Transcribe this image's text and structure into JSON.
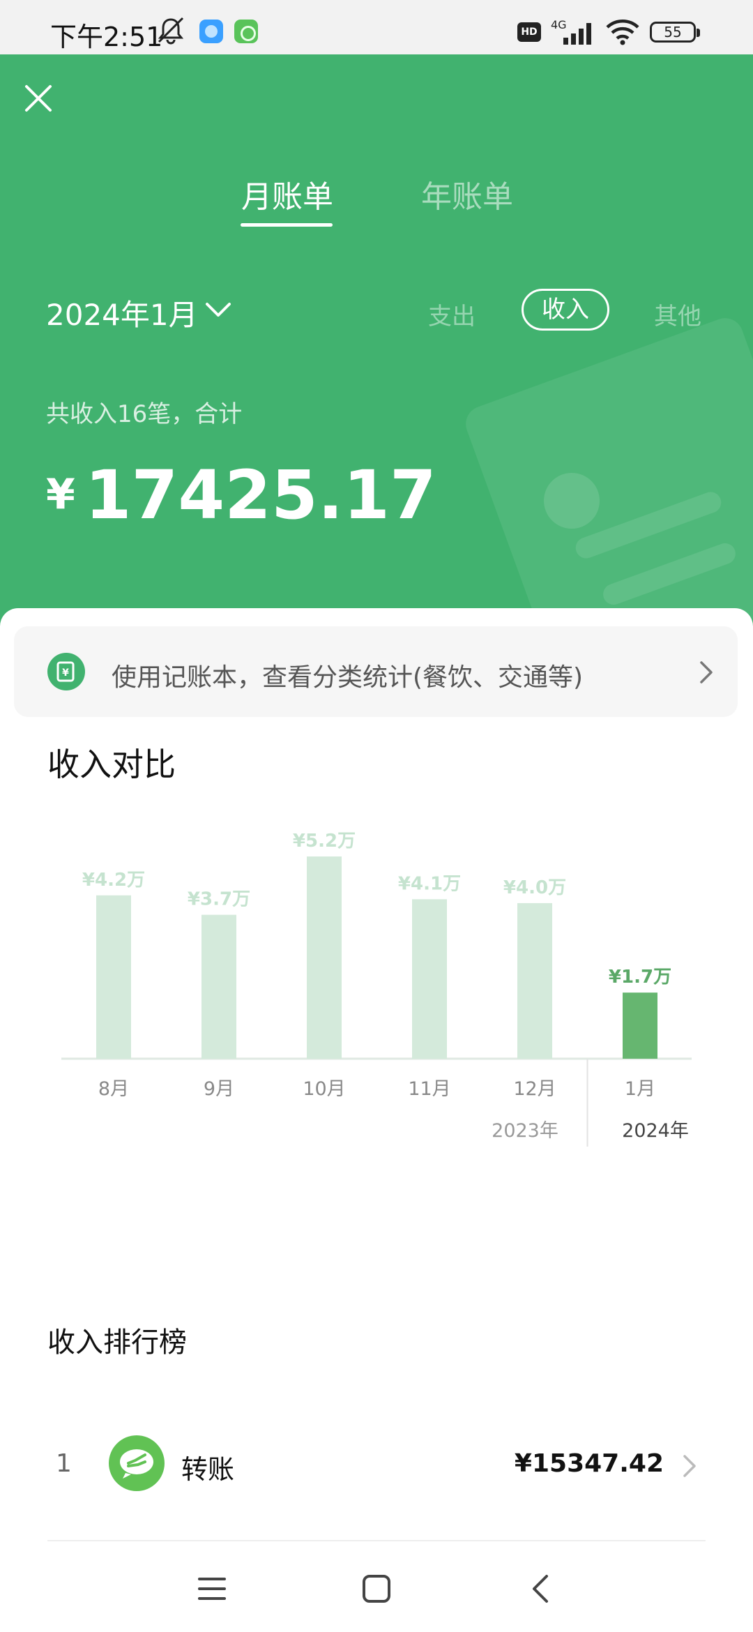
{
  "status_bar": {
    "time": "下午2:51",
    "hd": "HD",
    "network": "4G",
    "battery": "55"
  },
  "header": {
    "tabs": [
      {
        "label": "月账单",
        "active": true
      },
      {
        "label": "年账单",
        "active": false
      }
    ],
    "month": "2024年1月",
    "filters": [
      {
        "label": "支出",
        "active": false
      },
      {
        "label": "收入",
        "active": true
      },
      {
        "label": "其他",
        "active": false
      }
    ],
    "summary": "共收入16笔，合计",
    "currency": "¥",
    "total": "17425.17"
  },
  "banner": {
    "text": "使用记账本，查看分类统计(餐饮、交通等)"
  },
  "compare": {
    "title": "收入对比"
  },
  "chart_data": {
    "type": "bar",
    "categories": [
      "8月",
      "9月",
      "10月",
      "11月",
      "12月",
      "1月"
    ],
    "values": [
      4.2,
      3.7,
      5.2,
      4.1,
      4.0,
      1.7
    ],
    "value_labels": [
      "¥4.2万",
      "¥3.7万",
      "¥5.2万",
      "¥4.1万",
      "¥4.0万",
      "¥1.7万"
    ],
    "highlight_index": 5,
    "year_labels": [
      {
        "label": "2023年",
        "under_category": 4
      },
      {
        "label": "2024年",
        "under_category": 5
      }
    ],
    "ylim": [
      0,
      6
    ],
    "grid": false,
    "colors": {
      "bar": "#d4eadb",
      "highlight": "#66b670",
      "label": "#c5e3cf",
      "highlight_label": "#5aa867"
    }
  },
  "ranking": {
    "title": "收入排行榜",
    "items": [
      {
        "rank": "1",
        "name": "转账",
        "amount": "¥15347.42"
      }
    ]
  },
  "colors": {
    "brand": "#41b26f"
  }
}
